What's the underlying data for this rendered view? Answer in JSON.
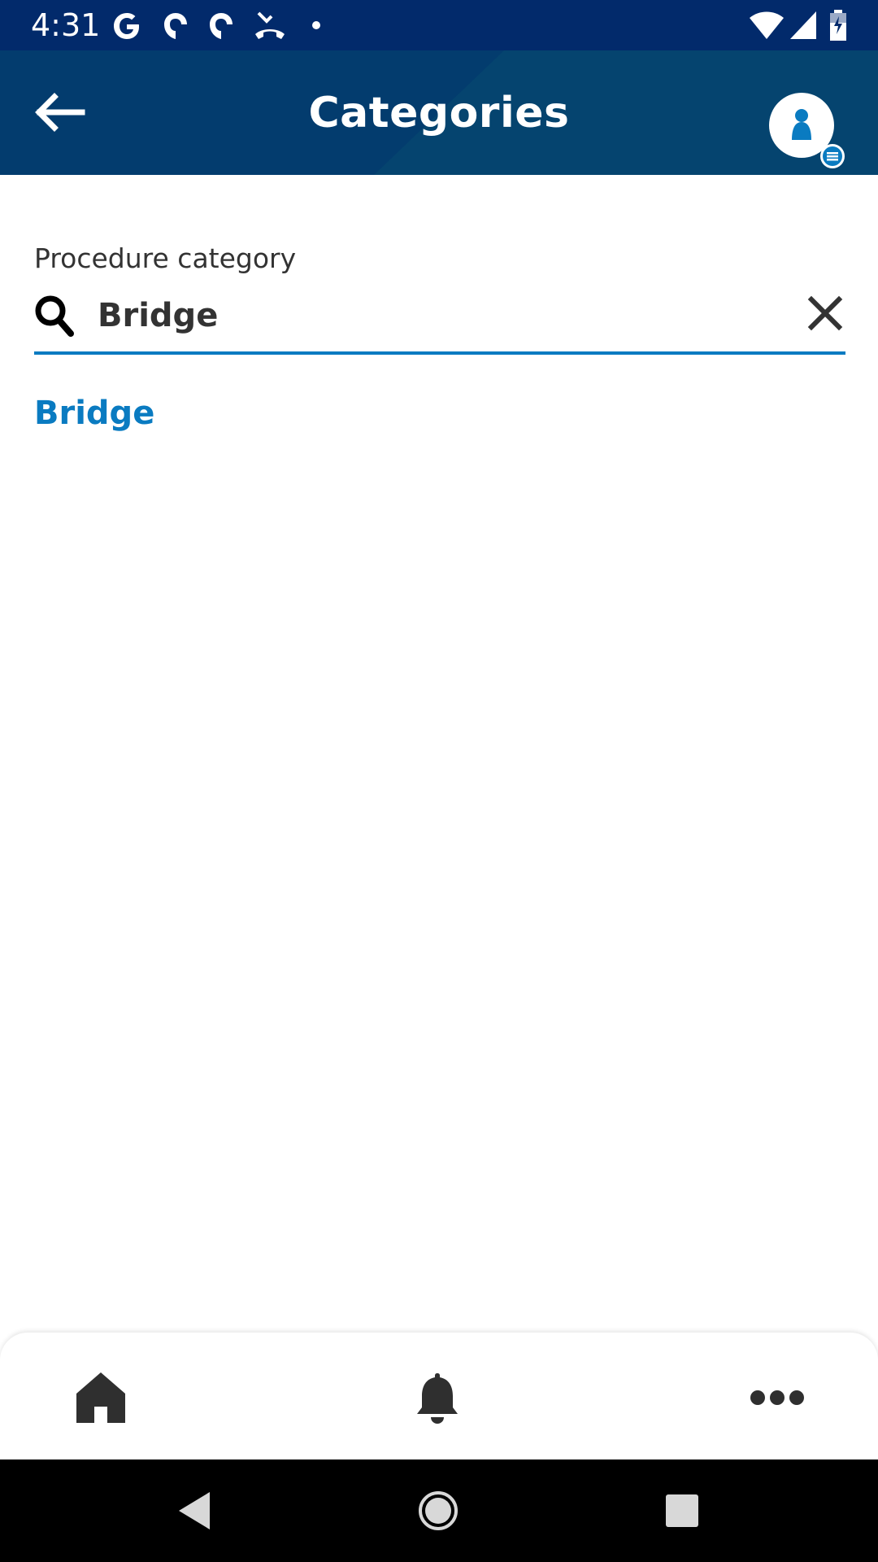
{
  "status_bar": {
    "time": "4:31",
    "left_icons": [
      "google-icon",
      "app-notification-icon",
      "app-notification-icon",
      "missed-call-icon",
      "dot-icon"
    ],
    "right_icons": [
      "wifi-icon",
      "signal-icon",
      "battery-icon"
    ]
  },
  "app_bar": {
    "title": "Categories",
    "back_icon": "arrow-left-icon",
    "avatar_icon": "user-avatar-icon"
  },
  "search": {
    "label": "Procedure category",
    "value": "Bridge",
    "placeholder": "",
    "search_icon": "search-icon",
    "clear_icon": "close-icon"
  },
  "results": [
    {
      "label": "Bridge"
    }
  ],
  "bottom_nav": {
    "items": [
      "home-icon",
      "bell-icon",
      "more-dots-icon"
    ]
  },
  "system_nav": {
    "items": [
      "back-triangle-icon",
      "home-circle-icon",
      "recents-square-icon"
    ]
  },
  "colors": {
    "status_bar": "#022a6b",
    "app_bar": "#033c6e",
    "accent": "#0a7bc1",
    "text_dark": "#333333"
  }
}
